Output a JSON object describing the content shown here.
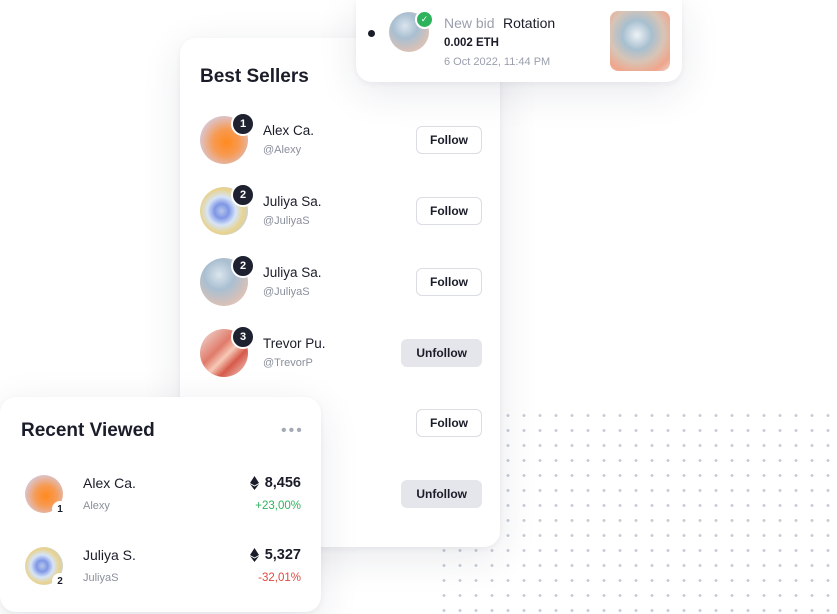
{
  "colors": {
    "positive": "#2fb25c",
    "negative": "#e0483e",
    "accent": "#1e2230"
  },
  "notification": {
    "label": "New bid",
    "item": "Rotation",
    "price": "0.002 ETH",
    "time": "6 Oct 2022, 11:44 PM",
    "icon": "verified-check-icon"
  },
  "best_sellers": {
    "title": "Best Sellers",
    "items": [
      {
        "rank": "1",
        "name": "Alex Ca.",
        "handle": "@Alexy",
        "action": "Follow"
      },
      {
        "rank": "2",
        "name": "Juliya Sa.",
        "handle": "@JuliyaS",
        "action": "Follow"
      },
      {
        "rank": "2",
        "name": "Juliya Sa.",
        "handle": "@JuliyaS",
        "action": "Follow"
      },
      {
        "rank": "3",
        "name": "Trevor Pu.",
        "handle": "@TrevorP",
        "action": "Unfollow"
      },
      {
        "action": "Follow"
      },
      {
        "action": "Unfollow"
      }
    ]
  },
  "recent_viewed": {
    "title": "Recent Viewed",
    "more_icon": "more-dots-icon",
    "items": [
      {
        "rank": "1",
        "name": "Alex Ca.",
        "handle": "Alexy",
        "value": "8,456",
        "change": "+23,00%"
      },
      {
        "rank": "2",
        "name": "Juliya S.",
        "handle": "JuliyaS",
        "value": "5,327",
        "change": "-32,01%"
      }
    ]
  }
}
